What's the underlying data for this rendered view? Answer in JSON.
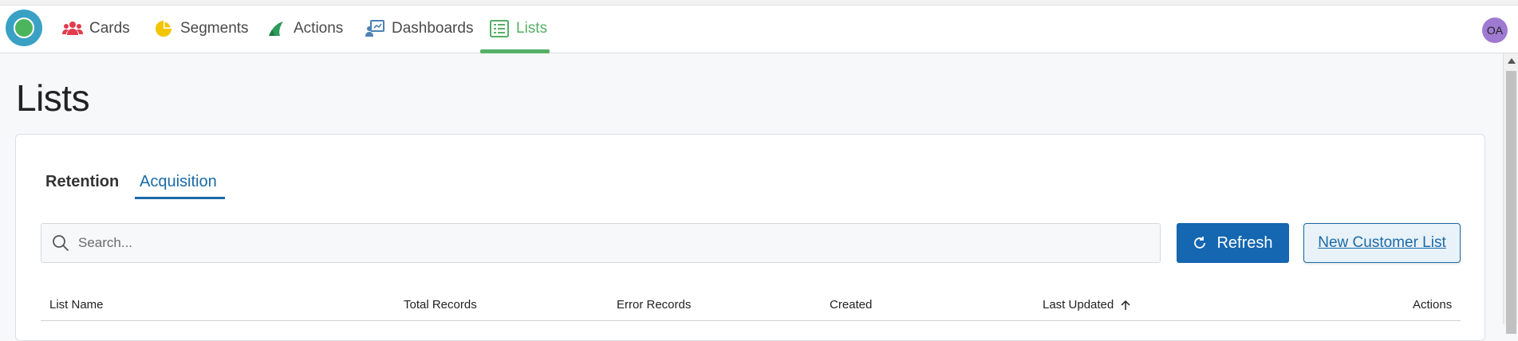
{
  "nav": {
    "items": [
      {
        "label": "Cards",
        "icon": "users-icon"
      },
      {
        "label": "Segments",
        "icon": "pie-chart-icon"
      },
      {
        "label": "Actions",
        "icon": "actions-icon"
      },
      {
        "label": "Dashboards",
        "icon": "dashboard-icon"
      },
      {
        "label": "Lists",
        "icon": "list-icon",
        "active": true
      }
    ],
    "avatar_initials": "OA"
  },
  "page": {
    "title": "Lists"
  },
  "tabs": [
    {
      "label": "Retention"
    },
    {
      "label": "Acquisition",
      "active": true
    }
  ],
  "search": {
    "placeholder": "Search...",
    "value": ""
  },
  "toolbar": {
    "refresh_label": "Refresh",
    "new_label": "New Customer List"
  },
  "table": {
    "columns": [
      "List Name",
      "Total Records",
      "Error Records",
      "Created",
      "Last Updated",
      "Actions"
    ],
    "sort": {
      "column": "Last Updated",
      "direction": "ascending"
    }
  },
  "colors": {
    "accent_green": "#56b066",
    "primary_blue": "#1467b0",
    "link_blue": "#1a6aa8",
    "avatar_purple": "#9f7ad2"
  }
}
